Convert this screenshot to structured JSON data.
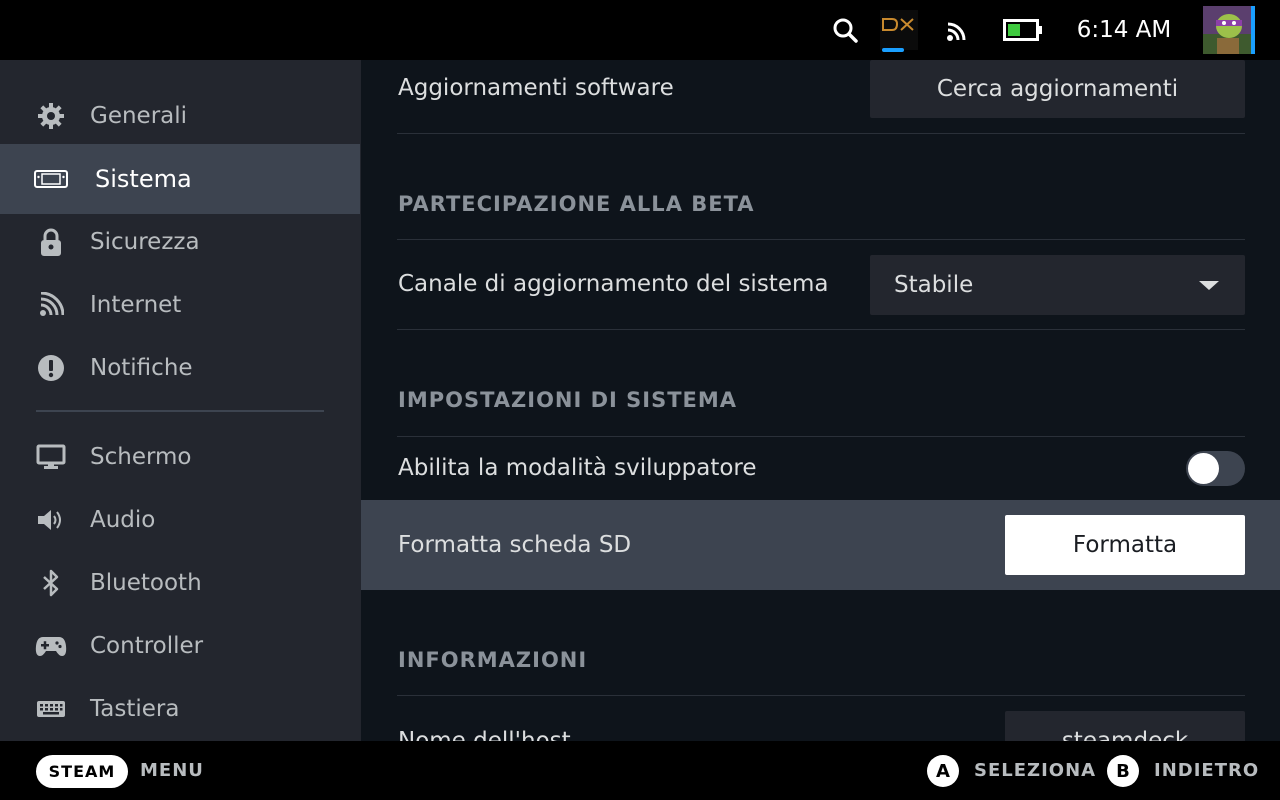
{
  "statusbar": {
    "time": "6:14 AM",
    "icons": [
      "search-icon",
      "dx-icon",
      "wifi-icon",
      "battery-icon",
      "avatar"
    ],
    "accent": "#1a9fff",
    "battery_color": "#3ec93e"
  },
  "sidebar": {
    "items": [
      {
        "label": "Generali",
        "icon": "gear-icon"
      },
      {
        "label": "Sistema",
        "icon": "steamdeck-icon",
        "active": true
      },
      {
        "label": "Sicurezza",
        "icon": "lock-icon"
      },
      {
        "label": "Internet",
        "icon": "wifi-icon"
      },
      {
        "label": "Notifiche",
        "icon": "alert-icon"
      },
      {
        "label": "Schermo",
        "icon": "monitor-icon"
      },
      {
        "label": "Audio",
        "icon": "speaker-icon"
      },
      {
        "label": "Bluetooth",
        "icon": "bluetooth-icon"
      },
      {
        "label": "Controller",
        "icon": "gamepad-icon"
      },
      {
        "label": "Tastiera",
        "icon": "keyboard-icon"
      }
    ]
  },
  "main": {
    "software_updates": {
      "label": "Aggiornamenti software",
      "button": "Cerca aggiornamenti"
    },
    "beta": {
      "title": "PARTECIPAZIONE ALLA BETA",
      "channel_label": "Canale di aggiornamento del sistema",
      "channel_value": "Stabile"
    },
    "system": {
      "title": "IMPOSTAZIONI DI SISTEMA",
      "dev_mode_label": "Abilita la modalità sviluppatore",
      "dev_mode_enabled": false,
      "format_label": "Formatta scheda SD",
      "format_button": "Formatta"
    },
    "info": {
      "title": "INFORMAZIONI",
      "hostname_label": "Nome dell'host",
      "hostname_value": "steamdeck"
    }
  },
  "bottombar": {
    "steam": "STEAM",
    "menu": "MENU",
    "a_key": "A",
    "select": "SELEZIONA",
    "b_key": "B",
    "back": "INDIETRO"
  }
}
